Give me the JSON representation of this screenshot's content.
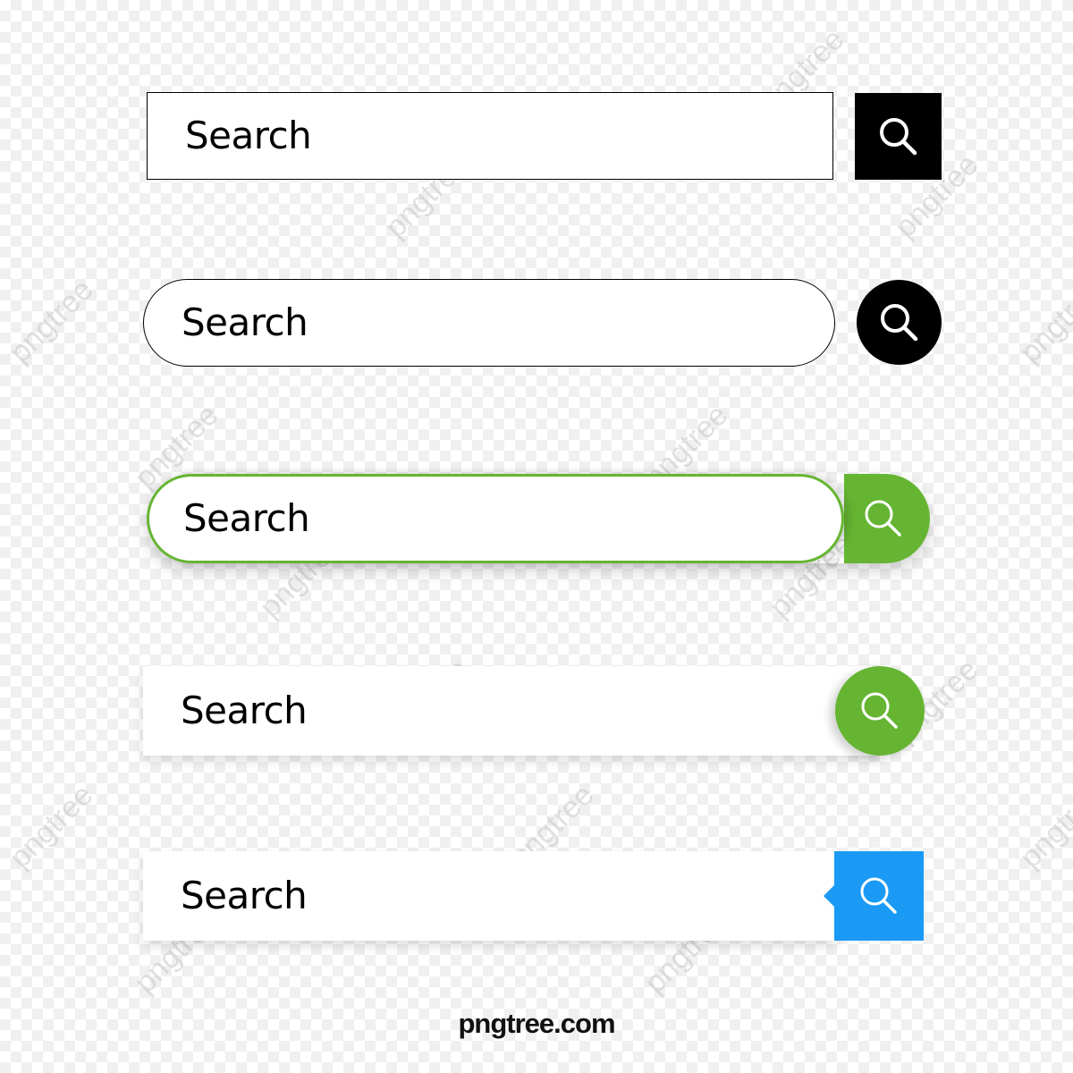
{
  "search_bars": [
    {
      "style": "square-outline",
      "text": "Search",
      "button_color": "#000000",
      "border_color": "#000000",
      "icon": "search-icon"
    },
    {
      "style": "pill-outline",
      "text": "Search",
      "button_color": "#000000",
      "border_color": "#000000",
      "icon": "search-icon"
    },
    {
      "style": "pill-green-combo",
      "text": "Search",
      "button_color": "#65b532",
      "border_color": "#65b532",
      "icon": "search-icon"
    },
    {
      "style": "flat-green-circle",
      "text": "Search",
      "button_color": "#65b532",
      "icon": "search-icon"
    },
    {
      "style": "flat-blue-square-pointer",
      "text": "Search",
      "button_color": "#1a9af5",
      "icon": "search-icon"
    }
  ],
  "watermark_text": "pngtree",
  "footer_logo": "pngtree.com",
  "colors": {
    "green": "#65b532",
    "blue": "#1a9af5",
    "black": "#000000"
  }
}
